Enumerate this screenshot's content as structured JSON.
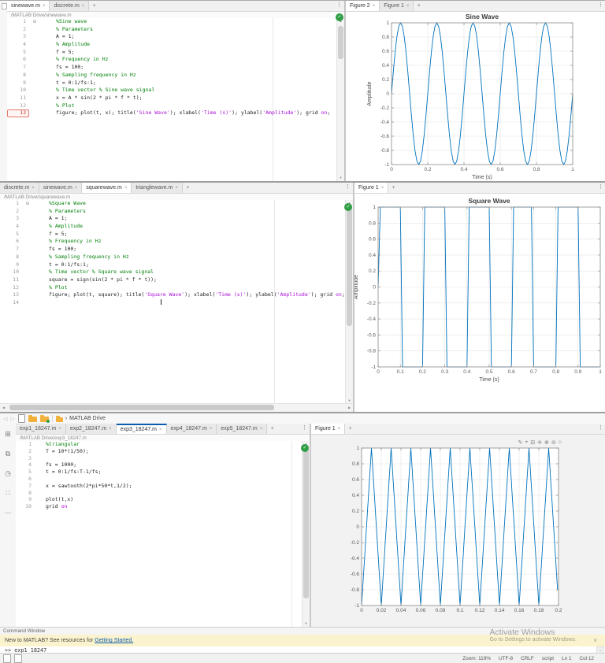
{
  "icons": {
    "close": "×",
    "plus": "+",
    "overflow": "⋮",
    "up": "▲",
    "down": "▼",
    "left": "◀",
    "right": "▶",
    "back": "◁",
    "forward": "▷",
    "check": "✓",
    "fold": "⊟",
    "chevron": "›",
    "caret_down": "⌄"
  },
  "window1": {
    "editor": {
      "tabs": [
        {
          "label": "sinewave.m",
          "active": true
        },
        {
          "label": "discrete.m",
          "active": false
        }
      ],
      "path": "/MATLAB Drive/sinewave.m",
      "lines": [
        {
          "n": "1",
          "fold": true,
          "s": [
            [
              "%Sine wave",
              "cm"
            ]
          ]
        },
        {
          "n": "2",
          "s": [
            [
              "% Parameters",
              "cm"
            ]
          ]
        },
        {
          "n": "3",
          "s": [
            [
              "A = 1;",
              ""
            ]
          ]
        },
        {
          "n": "4",
          "s": [
            [
              "% Amplitude",
              "cm"
            ]
          ]
        },
        {
          "n": "5",
          "s": [
            [
              "f = 5;",
              ""
            ]
          ]
        },
        {
          "n": "6",
          "s": [
            [
              "% Frequency in Hz",
              "cm"
            ]
          ]
        },
        {
          "n": "7",
          "s": [
            [
              "fs = 100;",
              ""
            ]
          ]
        },
        {
          "n": "8",
          "s": [
            [
              "% Sampling frequency in Hz",
              "cm"
            ]
          ]
        },
        {
          "n": "9",
          "s": [
            [
              "t = 0:1/fs:1;",
              ""
            ]
          ]
        },
        {
          "n": "10",
          "s": [
            [
              "% Time vector % Sine wave signal",
              "cm"
            ]
          ]
        },
        {
          "n": "11",
          "s": [
            [
              "x = A * sin(2 * pi * f * t);",
              ""
            ]
          ]
        },
        {
          "n": "12",
          "s": [
            [
              "% Plot",
              "cm"
            ]
          ]
        },
        {
          "n": "13",
          "red": true,
          "s": [
            [
              "figure; plot(t, x); title(",
              ""
            ],
            [
              "'Sine Wave'",
              "st"
            ],
            [
              "); xlabel(",
              ""
            ],
            [
              "'Time (s)'",
              "st"
            ],
            [
              "); ylabel(",
              ""
            ],
            [
              "'Amplitude'",
              "st"
            ],
            [
              "); grid ",
              ""
            ],
            [
              "on",
              "st"
            ],
            [
              ";",
              ""
            ]
          ]
        }
      ]
    },
    "figure": {
      "tabs": [
        {
          "label": "Figure 2",
          "active": true
        },
        {
          "label": "Figure 1",
          "active": false
        }
      ]
    }
  },
  "window2": {
    "editor": {
      "tabs": [
        {
          "label": "discrete.m",
          "active": false
        },
        {
          "label": "sinewave.m",
          "active": false
        },
        {
          "label": "squarewave.m",
          "active": true
        },
        {
          "label": "trianglewave.m",
          "active": false
        }
      ],
      "path": "/MATLAB Drive/squarewave.m",
      "lines": [
        {
          "n": "1",
          "fold": true,
          "s": [
            [
              "%Square Wave",
              "cm"
            ]
          ]
        },
        {
          "n": "2",
          "s": [
            [
              "% Parameters",
              "cm"
            ]
          ]
        },
        {
          "n": "3",
          "s": [
            [
              "A = 1;",
              ""
            ]
          ]
        },
        {
          "n": "4",
          "s": [
            [
              "% Amplitude",
              "cm"
            ]
          ]
        },
        {
          "n": "5",
          "s": [
            [
              "f = 5;",
              ""
            ]
          ]
        },
        {
          "n": "6",
          "s": [
            [
              "% Frequency in Hz",
              "cm"
            ]
          ]
        },
        {
          "n": "7",
          "s": [
            [
              "fs = 100;",
              ""
            ]
          ]
        },
        {
          "n": "8",
          "s": [
            [
              "% Sampling frequency in Hz",
              "cm"
            ]
          ]
        },
        {
          "n": "9",
          "s": [
            [
              "t = 0:1/fs:1;",
              ""
            ]
          ]
        },
        {
          "n": "10",
          "s": [
            [
              "% Time vector % Square wave signal",
              "cm"
            ]
          ]
        },
        {
          "n": "11",
          "s": [
            [
              "square = sign(sin(2 * pi * f * t));",
              ""
            ]
          ]
        },
        {
          "n": "12",
          "s": [
            [
              "% Plot",
              "cm"
            ]
          ]
        },
        {
          "n": "13",
          "s": [
            [
              "figure; plot(t, square); title(",
              ""
            ],
            [
              "'Square Wave'",
              "st"
            ],
            [
              "); xlabel(",
              ""
            ],
            [
              "'Time (s)'",
              "st"
            ],
            [
              "); ylabel(",
              ""
            ],
            [
              "'Amplitude'",
              "st"
            ],
            [
              "); grid ",
              ""
            ],
            [
              "on",
              "st"
            ],
            [
              ";",
              ""
            ]
          ]
        },
        {
          "n": "14",
          "cursor": true,
          "s": []
        }
      ]
    },
    "figure": {
      "tabs": [
        {
          "label": "Figure 1",
          "active": true
        }
      ]
    }
  },
  "window3": {
    "toolbar": {
      "breadcrumb_label": "MATLAB Drive"
    },
    "sidebar_icons": [
      {
        "name": "panel-layout-icon",
        "glyph": "⊞"
      },
      {
        "name": "preview-icon",
        "glyph": "⧉"
      },
      {
        "name": "versions-history-icon",
        "glyph": "◷"
      },
      {
        "name": "apps-icon",
        "glyph": "∷"
      },
      {
        "name": "more-tools-icon",
        "glyph": "⋯"
      }
    ],
    "editor": {
      "tabs": [
        {
          "label": "exp1_18247.m",
          "active": false
        },
        {
          "label": "exp2_18247.m",
          "active": false
        },
        {
          "label": "exp3_18247.m",
          "active": true
        },
        {
          "label": "exp4_18247.m",
          "active": false
        },
        {
          "label": "exp5_18247.m",
          "active": false
        }
      ],
      "path": "/MATLAB Drive/exp3_18247.m",
      "lines": [
        {
          "n": "1",
          "s": [
            [
              "%triangular",
              "cm"
            ]
          ]
        },
        {
          "n": "2",
          "s": [
            [
              "T = 10*(1/50);",
              ""
            ]
          ]
        },
        {
          "n": "3",
          "s": []
        },
        {
          "n": "4",
          "s": [
            [
              "fs = 1000;",
              ""
            ]
          ]
        },
        {
          "n": "5",
          "s": [
            [
              "t = 0:1/fs:T-1/fs;",
              ""
            ]
          ]
        },
        {
          "n": "6",
          "s": []
        },
        {
          "n": "7",
          "s": [
            [
              "x = sawtooth(2*pi*50*t,1/2);",
              ""
            ]
          ]
        },
        {
          "n": "8",
          "s": []
        },
        {
          "n": "9",
          "s": [
            [
              "plot(t,x)",
              ""
            ]
          ]
        },
        {
          "n": "10",
          "s": [
            [
              "grid ",
              ""
            ],
            [
              "on",
              "st"
            ]
          ]
        }
      ]
    },
    "figure": {
      "tabs": [
        {
          "label": "Figure 1",
          "active": true
        }
      ],
      "plot_toolbar": [
        {
          "name": "save-figure-icon",
          "glyph": "✎"
        },
        {
          "name": "brush-icon",
          "glyph": "⌖"
        },
        {
          "name": "datatips-icon",
          "glyph": "⊟"
        },
        {
          "name": "pan-icon",
          "glyph": "✛"
        },
        {
          "name": "zoom-in-icon",
          "glyph": "⊕"
        },
        {
          "name": "zoom-out-icon",
          "glyph": "⊖"
        },
        {
          "name": "restore-view-icon",
          "glyph": "⌂"
        }
      ]
    },
    "command_window": {
      "title": "Command Window",
      "banner_text": "New to MATLAB? See resources for ",
      "banner_link_label": "Getting Started.",
      "prompt": ">>",
      "command": "exp1_18247"
    },
    "watermark": {
      "line1": "Activate Windows",
      "line2": "Go to Settings to activate Windows."
    },
    "status_bar": {
      "items": [
        "Zoom: 119%",
        "UTF-8",
        "CRLF",
        "script",
        "Ln 1",
        "Col 12"
      ]
    }
  },
  "chart_data": [
    {
      "type": "line",
      "title": "Sine Wave",
      "xlabel": "Time (s)",
      "ylabel": "Amplitude",
      "xlim": [
        0,
        1
      ],
      "ylim": [
        -1,
        1
      ],
      "xticks": [
        "0",
        "0.2",
        "0.4",
        "0.6",
        "0.8",
        "1"
      ],
      "yticks": [
        "-1",
        "-0.8",
        "-0.6",
        "-0.4",
        "-0.2",
        "0",
        "0.2",
        "0.4",
        "0.6",
        "0.8",
        "1"
      ],
      "grid": true,
      "line_color": "#0072BD",
      "waveform": {
        "kind": "sine",
        "amplitude": 1,
        "frequency_hz": 5,
        "sample_rate_hz": 100,
        "duration_s": 1
      }
    },
    {
      "type": "line",
      "title": "Square Wave",
      "xlabel": "Time (s)",
      "ylabel": "Amplitude",
      "xlim": [
        0,
        1
      ],
      "ylim": [
        -1,
        1
      ],
      "xticks": [
        "0",
        "0.1",
        "0.2",
        "0.3",
        "0.4",
        "0.5",
        "0.6",
        "0.7",
        "0.8",
        "0.9",
        "1"
      ],
      "yticks": [
        "-1",
        "-0.8",
        "-0.6",
        "-0.4",
        "-0.2",
        "0",
        "0.2",
        "0.4",
        "0.6",
        "0.8",
        "1"
      ],
      "grid": true,
      "line_color": "#0072BD",
      "waveform": {
        "kind": "square",
        "amplitude": 1,
        "frequency_hz": 5,
        "sample_rate_hz": 100,
        "duration_s": 1
      }
    },
    {
      "type": "line",
      "title": "",
      "xlabel": "",
      "ylabel": "",
      "xlim": [
        0,
        0.2
      ],
      "ylim": [
        -1,
        1
      ],
      "xticks": [
        "0",
        "0.02",
        "0.04",
        "0.06",
        "0.08",
        "0.1",
        "0.12",
        "0.14",
        "0.16",
        "0.18",
        "0.2"
      ],
      "yticks": [
        "-1",
        "-0.8",
        "-0.6",
        "-0.4",
        "-0.2",
        "0",
        "0.2",
        "0.4",
        "0.6",
        "0.8",
        "1"
      ],
      "grid": true,
      "line_color": "#0072BD",
      "waveform": {
        "kind": "triangle",
        "amplitude": 1,
        "frequency_hz": 50,
        "sample_rate_hz": 1000,
        "duration_s": 0.199
      }
    }
  ]
}
